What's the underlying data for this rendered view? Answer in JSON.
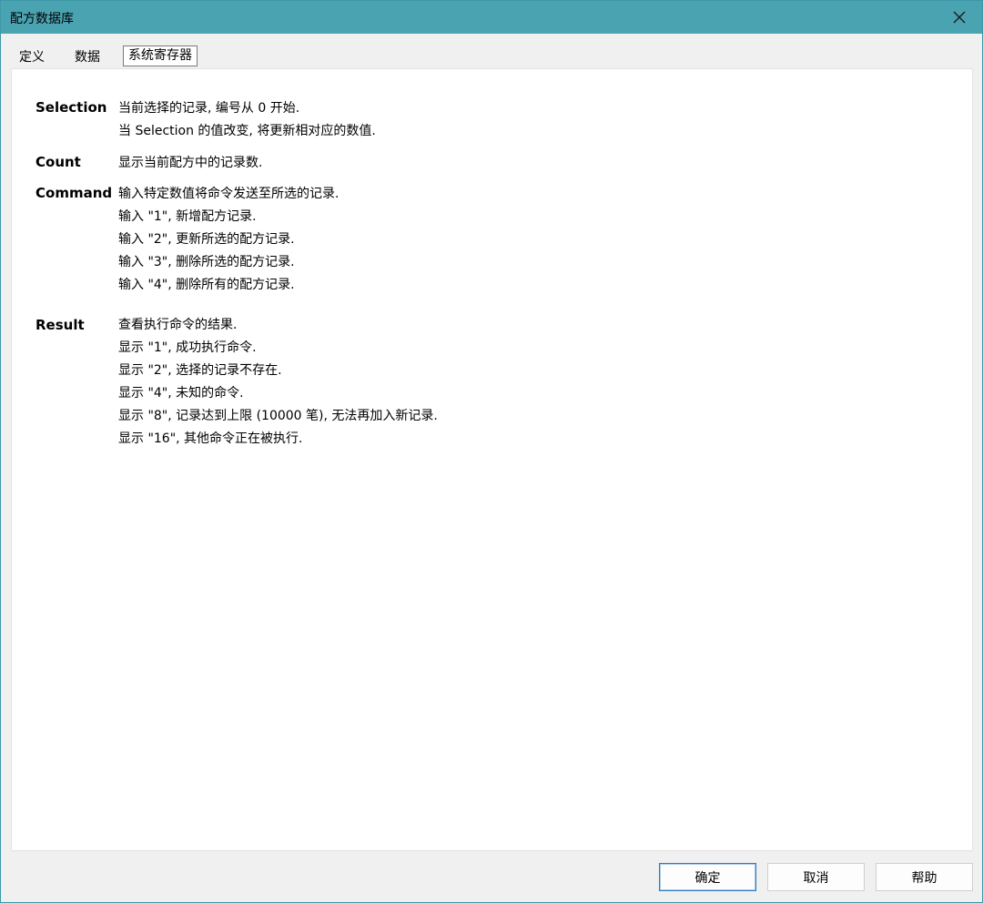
{
  "window": {
    "title": "配方数据库"
  },
  "tabs": [
    {
      "label": "定义"
    },
    {
      "label": "数据"
    },
    {
      "label": "系统寄存器"
    }
  ],
  "registers": [
    {
      "name": "Selection",
      "lines": [
        "当前选择的记录, 编号从 0 开始.",
        "当 Selection 的值改变, 将更新相对应的数值."
      ]
    },
    {
      "name": "Count",
      "lines": [
        "显示当前配方中的记录数."
      ]
    },
    {
      "name": "Command",
      "lines": [
        "输入特定数值将命令发送至所选的记录.",
        "输入 \"1\", 新增配方记录.",
        "输入 \"2\", 更新所选的配方记录.",
        "输入 \"3\", 删除所选的配方记录.",
        "输入 \"4\", 删除所有的配方记录."
      ]
    },
    {
      "name": "Result",
      "lines": [
        "查看执行命令的结果.",
        "显示 \"1\", 成功执行命令.",
        "显示 \"2\", 选择的记录不存在.",
        "显示 \"4\", 未知的命令.",
        "显示 \"8\", 记录达到上限 (10000 笔), 无法再加入新记录.",
        "显示 \"16\", 其他命令正在被执行."
      ]
    }
  ],
  "buttons": {
    "ok": "确定",
    "cancel": "取消",
    "help": "帮助"
  },
  "colors": {
    "titlebar": "#4aa3b1",
    "panel": "#ffffff",
    "window_bg": "#f0f0f0"
  }
}
